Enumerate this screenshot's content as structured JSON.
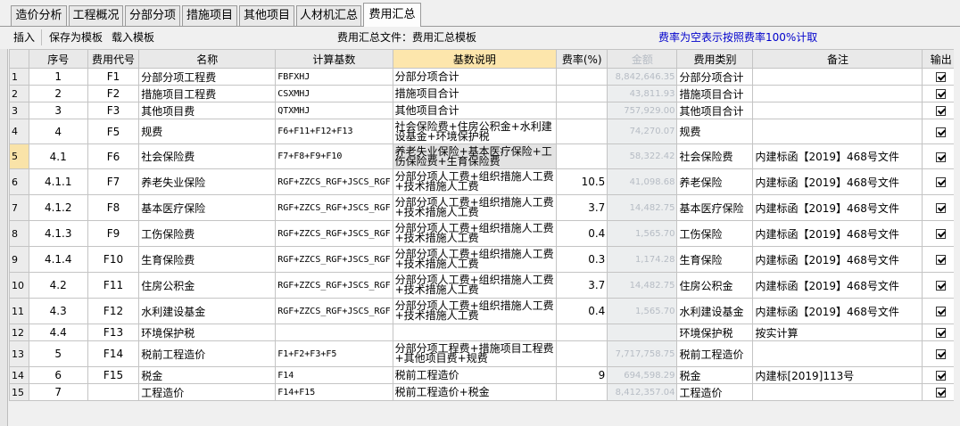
{
  "tabs": [
    {
      "label": "造价分析",
      "active": false
    },
    {
      "label": "工程概况",
      "active": false
    },
    {
      "label": "分部分项",
      "active": false
    },
    {
      "label": "措施项目",
      "active": false
    },
    {
      "label": "其他项目",
      "active": false
    },
    {
      "label": "人材机汇总",
      "active": false
    },
    {
      "label": "费用汇总",
      "active": true
    }
  ],
  "toolbar": {
    "insert_label": "插入",
    "save_template_label": "保存为模板",
    "load_template_label": "载入模板",
    "file_label": "费用汇总文件：费用汇总模板",
    "note": "费率为空表示按照费率100%计取"
  },
  "columns": [
    "序号",
    "费用代号",
    "名称",
    "计算基数",
    "基数说明",
    "费率(%)",
    "金额",
    "费用类别",
    "备注",
    "输出"
  ],
  "rows": [
    {
      "idx": "1",
      "seq": "1",
      "code": "F1",
      "name": "分部分项工程费",
      "base": "FBFXHJ",
      "desc": "分部分项合计",
      "rate": "",
      "amount": "8,842,646.35",
      "category": "分部分项合计",
      "remark": "",
      "output": true
    },
    {
      "idx": "2",
      "seq": "2",
      "code": "F2",
      "name": "措施项目工程费",
      "base": "CSXMHJ",
      "desc": "措施项目合计",
      "rate": "",
      "amount": "43,811.93",
      "category": "措施项目合计",
      "remark": "",
      "output": true
    },
    {
      "idx": "3",
      "seq": "3",
      "code": "F3",
      "name": "其他项目费",
      "base": "QTXMHJ",
      "desc": "其他项目合计",
      "rate": "",
      "amount": "757,929.00",
      "category": "其他项目合计",
      "remark": "",
      "output": true
    },
    {
      "idx": "4",
      "seq": "4",
      "code": "F5",
      "name": "规费",
      "base": "F6+F11+F12+F13",
      "desc": "社会保险费+住房公积金+水利建设基金+环境保护税",
      "rate": "",
      "amount": "74,270.07",
      "category": "规费",
      "remark": "",
      "output": true
    },
    {
      "idx": "5",
      "seq": "4.1",
      "code": "F6",
      "name": "社会保险费",
      "base": "F7+F8+F9+F10",
      "desc": "养老失业保险+基本医疗保险+工伤保险费+生育保险费",
      "rate": "",
      "amount": "58,322.42",
      "category": "社会保险费",
      "remark": "内建标函【2019】468号文件",
      "output": true
    },
    {
      "idx": "6",
      "seq": "4.1.1",
      "code": "F7",
      "name": "养老失业保险",
      "base": "RGF+ZZCS_RGF+JSCS_RGF",
      "desc": "分部分项人工费+组织措施人工费+技术措施人工费",
      "rate": "10.5",
      "amount": "41,098.68",
      "category": "养老保险",
      "remark": "内建标函【2019】468号文件",
      "output": true
    },
    {
      "idx": "7",
      "seq": "4.1.2",
      "code": "F8",
      "name": "基本医疗保险",
      "base": "RGF+ZZCS_RGF+JSCS_RGF",
      "desc": "分部分项人工费+组织措施人工费+技术措施人工费",
      "rate": "3.7",
      "amount": "14,482.75",
      "category": "基本医疗保险",
      "remark": "内建标函【2019】468号文件",
      "output": true
    },
    {
      "idx": "8",
      "seq": "4.1.3",
      "code": "F9",
      "name": "工伤保险费",
      "base": "RGF+ZZCS_RGF+JSCS_RGF",
      "desc": "分部分项人工费+组织措施人工费+技术措施人工费",
      "rate": "0.4",
      "amount": "1,565.70",
      "category": "工伤保险",
      "remark": "内建标函【2019】468号文件",
      "output": true
    },
    {
      "idx": "9",
      "seq": "4.1.4",
      "code": "F10",
      "name": "生育保险费",
      "base": "RGF+ZZCS_RGF+JSCS_RGF",
      "desc": "分部分项人工费+组织措施人工费+技术措施人工费",
      "rate": "0.3",
      "amount": "1,174.28",
      "category": "生育保险",
      "remark": "内建标函【2019】468号文件",
      "output": true
    },
    {
      "idx": "10",
      "seq": "4.2",
      "code": "F11",
      "name": "住房公积金",
      "base": "RGF+ZZCS_RGF+JSCS_RGF",
      "desc": "分部分项人工费+组织措施人工费+技术措施人工费",
      "rate": "3.7",
      "amount": "14,482.75",
      "category": "住房公积金",
      "remark": "内建标函【2019】468号文件",
      "output": true
    },
    {
      "idx": "11",
      "seq": "4.3",
      "code": "F12",
      "name": "水利建设基金",
      "base": "RGF+ZZCS_RGF+JSCS_RGF",
      "desc": "分部分项人工费+组织措施人工费+技术措施人工费",
      "rate": "0.4",
      "amount": "1,565.70",
      "category": "水利建设基金",
      "remark": "内建标函【2019】468号文件",
      "output": true
    },
    {
      "idx": "12",
      "seq": "4.4",
      "code": "F13",
      "name": "环境保护税",
      "base": "",
      "desc": "",
      "rate": "",
      "amount": "",
      "category": "环境保护税",
      "remark": "按实计算",
      "output": true
    },
    {
      "idx": "13",
      "seq": "5",
      "code": "F14",
      "name": "税前工程造价",
      "base": "F1+F2+F3+F5",
      "desc": "分部分项工程费+措施项目工程费+其他项目费+规费",
      "rate": "",
      "amount": "7,717,758.75",
      "category": "税前工程造价",
      "remark": "",
      "output": true
    },
    {
      "idx": "14",
      "seq": "6",
      "code": "F15",
      "name": "税金",
      "base": "F14",
      "desc": "税前工程造价",
      "rate": "9",
      "amount": "694,598.29",
      "category": "税金",
      "remark": "内建标[2019]113号",
      "output": true
    },
    {
      "idx": "15",
      "seq": "7",
      "code": "",
      "name": "工程造价",
      "base": "F14+F15",
      "desc": "税前工程造价+税金",
      "rate": "",
      "amount": "8,412,357.04",
      "category": "工程造价",
      "remark": "",
      "output": true
    }
  ],
  "selected_row": "5"
}
